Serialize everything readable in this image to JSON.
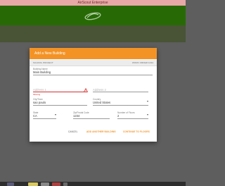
{
  "window": {
    "title": "AirScout Enterprise"
  },
  "colors": {
    "header_bg": "#276a05",
    "accent": "#f39325",
    "error": "#d32f2f",
    "overlay": "#5e5e5e"
  },
  "dialog": {
    "title": "Add a New Building",
    "project_label": "SCHOOL PROJECT",
    "order_label": "WORK ORDER 1234",
    "fields": {
      "building_name": {
        "label": "Building Name",
        "value": "Main Building"
      },
      "address1": {
        "placeholder": "Address 1",
        "error": "Missing"
      },
      "address2": {
        "placeholder": "Address 2"
      },
      "city": {
        "label": "City/Town",
        "value": "sao paulo"
      },
      "country": {
        "label": "Country",
        "value": "United States"
      },
      "state": {
        "label": "State",
        "value": "CA"
      },
      "zip": {
        "label": "Zip/Postal Code",
        "value": "1234"
      },
      "floors": {
        "label": "Number of Floors",
        "value": "2"
      }
    },
    "buttons": {
      "cancel": "CANCEL",
      "add_another": "ADD ANOTHER BUILDING",
      "continue": "CONTINUE TO FLOORS"
    }
  }
}
